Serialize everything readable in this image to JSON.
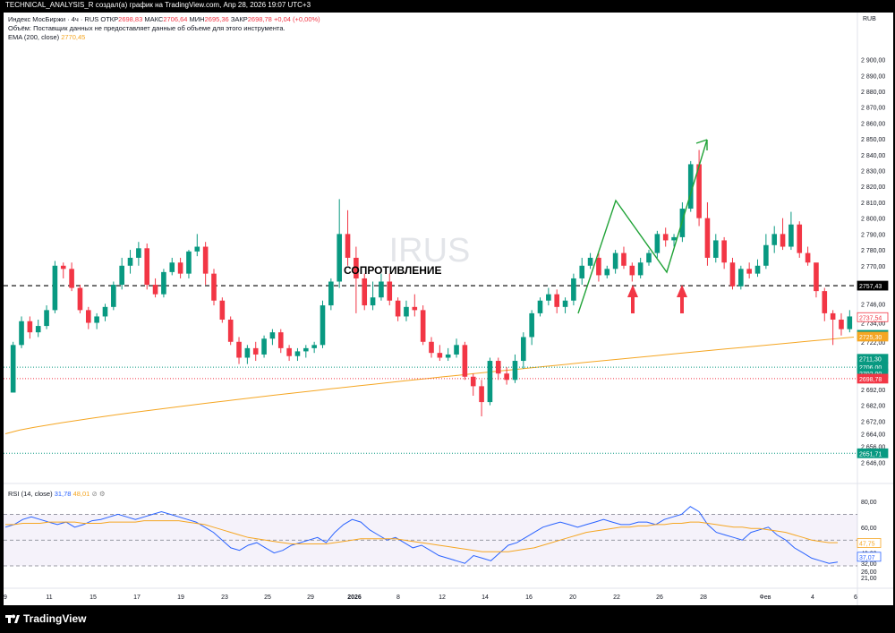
{
  "header": {
    "attribution": "TECHNICAL_ANALYSIS_R создал(а) график на TradingView.com, Апр 28, 2026 19:07 UTC+3"
  },
  "legend": {
    "symbol": "Индекс МосБиржи · 4ч · RUS",
    "open_label": "ОТКР",
    "open": "2698,83",
    "high_label": "МАКС",
    "high": "2706,64",
    "low_label": "МИН",
    "low": "2695,36",
    "close_label": "ЗАКР",
    "close": "2698,78",
    "change": "+0,04 (+0,00%)",
    "volume_note": "Объём: Поставщик данных не предоставляет данные об объеме для этого инструмента.",
    "ema_label": "EMA (200, close)",
    "ema_value": "2770,45",
    "rsi_label": "RSI (14, close)",
    "rsi_value": "31,78",
    "rsi_ma": "48,01"
  },
  "watermark": "IRUS",
  "annotation": "СОПРОТИВЛЕНИЕ",
  "currency": "RUB",
  "branding": "TradingView",
  "colors": {
    "up": "#089981",
    "down": "#f23645",
    "ema": "#f5a623",
    "rsi": "#2962ff",
    "rsi_ma": "#f5a623",
    "arrow_green": "#21a338",
    "arrow_red": "#f23645"
  },
  "chart_data": [
    {
      "type": "candlestick",
      "title": "Индекс МосБиржи · 4ч · RUS",
      "ylim": [
        2640,
        2915
      ],
      "y_ticks": [
        "2 900,00",
        "2 890,00",
        "2 880,00",
        "2 870,00",
        "2 860,00",
        "2 850,00",
        "2 840,00",
        "2 830,00",
        "2 820,00",
        "2 810,00",
        "2 800,00",
        "2 790,00",
        "2 780,00",
        "2 770,00",
        "2 757,43",
        "2 746,00",
        "2 734,00",
        "2 722,00",
        "2 711,30",
        "2 706,00",
        "2 698,78",
        "2 692,00",
        "2 682,00",
        "2 672,00",
        "2 664,00",
        "2 656,00",
        "2 651,71",
        "2 646,00"
      ],
      "x_ticks": [
        "9",
        "11",
        "15",
        "17",
        "19",
        "23",
        "25",
        "29",
        "2026",
        "8",
        "12",
        "14",
        "16",
        "20",
        "22",
        "26",
        "28",
        "Фев",
        "4",
        "6"
      ],
      "price_tags": [
        {
          "label": "2757,43",
          "value": 2757.43,
          "color": "#000000"
        },
        {
          "label": "2737,54",
          "value": 2737.54,
          "color": "#f23645"
        },
        {
          "label": "2726,40",
          "value": 2726.4,
          "color": "#089981"
        },
        {
          "label": "2725,30",
          "value": 2725.3,
          "color": "#f5a623"
        },
        {
          "label": "2711,30",
          "value": 2711.3,
          "color": "#089981"
        },
        {
          "label": "2706,00",
          "value": 2706.0,
          "color": "#089981"
        },
        {
          "label": "2702,00",
          "value": 2702.0,
          "color": "#089981"
        },
        {
          "label": "2698,78",
          "value": 2698.78,
          "color": "#f23645"
        },
        {
          "label": "2651,71",
          "value": 2651.71,
          "color": "#089981"
        }
      ],
      "resistance": 2757.43,
      "support_dotted": [
        2706.0,
        2651.71
      ],
      "candles": [
        [
          2690,
          2720,
          2690,
          2722
        ],
        [
          2720,
          2735,
          2718,
          2738
        ],
        [
          2735,
          2728,
          2724,
          2738
        ],
        [
          2728,
          2732,
          2725,
          2736
        ],
        [
          2732,
          2742,
          2730,
          2745
        ],
        [
          2742,
          2770,
          2740,
          2773
        ],
        [
          2770,
          2768,
          2762,
          2772
        ],
        [
          2768,
          2756,
          2754,
          2772
        ],
        [
          2756,
          2742,
          2740,
          2758
        ],
        [
          2742,
          2734,
          2730,
          2744
        ],
        [
          2734,
          2738,
          2730,
          2740
        ],
        [
          2738,
          2744,
          2735,
          2746
        ],
        [
          2744,
          2758,
          2742,
          2760
        ],
        [
          2758,
          2770,
          2755,
          2775
        ],
        [
          2770,
          2775,
          2765,
          2780
        ],
        [
          2775,
          2781,
          2770,
          2785
        ],
        [
          2781,
          2758,
          2755,
          2784
        ],
        [
          2758,
          2752,
          2750,
          2762
        ],
        [
          2752,
          2766,
          2750,
          2768
        ],
        [
          2766,
          2772,
          2764,
          2775
        ],
        [
          2772,
          2765,
          2762,
          2775
        ],
        [
          2765,
          2779,
          2762,
          2780
        ],
        [
          2779,
          2782,
          2776,
          2790
        ],
        [
          2782,
          2765,
          2758,
          2785
        ],
        [
          2765,
          2748,
          2745,
          2768
        ],
        [
          2748,
          2736,
          2734,
          2750
        ],
        [
          2736,
          2722,
          2720,
          2738
        ],
        [
          2722,
          2712,
          2708,
          2725
        ],
        [
          2712,
          2718,
          2708,
          2720
        ],
        [
          2718,
          2714,
          2710,
          2722
        ],
        [
          2714,
          2724,
          2712,
          2726
        ],
        [
          2724,
          2728,
          2720,
          2730
        ],
        [
          2728,
          2718,
          2715,
          2730
        ],
        [
          2718,
          2713,
          2710,
          2720
        ],
        [
          2713,
          2716,
          2710,
          2718
        ],
        [
          2716,
          2718,
          2712,
          2720
        ],
        [
          2718,
          2720,
          2715,
          2722
        ],
        [
          2720,
          2745,
          2718,
          2748
        ],
        [
          2745,
          2760,
          2742,
          2762
        ],
        [
          2760,
          2790,
          2756,
          2812
        ],
        [
          2790,
          2775,
          2770,
          2805
        ],
        [
          2775,
          2762,
          2740,
          2782
        ],
        [
          2762,
          2745,
          2742,
          2765
        ],
        [
          2745,
          2750,
          2742,
          2760
        ],
        [
          2750,
          2760,
          2748,
          2765
        ],
        [
          2760,
          2748,
          2745,
          2765
        ],
        [
          2748,
          2738,
          2735,
          2750
        ],
        [
          2738,
          2744,
          2735,
          2748
        ],
        [
          2744,
          2742,
          2738,
          2752
        ],
        [
          2742,
          2722,
          2720,
          2745
        ],
        [
          2722,
          2715,
          2712,
          2725
        ],
        [
          2715,
          2712,
          2710,
          2720
        ],
        [
          2712,
          2714,
          2710,
          2718
        ],
        [
          2714,
          2720,
          2712,
          2724
        ],
        [
          2720,
          2700,
          2698,
          2722
        ],
        [
          2700,
          2694,
          2688,
          2702
        ],
        [
          2694,
          2684,
          2675,
          2698
        ],
        [
          2684,
          2710,
          2682,
          2712
        ],
        [
          2710,
          2702,
          2698,
          2712
        ],
        [
          2702,
          2698,
          2695,
          2706
        ],
        [
          2698,
          2710,
          2696,
          2714
        ],
        [
          2710,
          2725,
          2705,
          2728
        ],
        [
          2725,
          2740,
          2720,
          2742
        ],
        [
          2740,
          2748,
          2738,
          2750
        ],
        [
          2748,
          2752,
          2745,
          2756
        ],
        [
          2752,
          2744,
          2740,
          2755
        ],
        [
          2744,
          2748,
          2740,
          2750
        ],
        [
          2748,
          2762,
          2745,
          2765
        ],
        [
          2762,
          2770,
          2758,
          2775
        ],
        [
          2770,
          2775,
          2768,
          2778
        ],
        [
          2775,
          2764,
          2760,
          2778
        ],
        [
          2764,
          2768,
          2762,
          2770
        ],
        [
          2768,
          2778,
          2765,
          2780
        ],
        [
          2778,
          2770,
          2768,
          2782
        ],
        [
          2770,
          2764,
          2760,
          2772
        ],
        [
          2764,
          2772,
          2762,
          2775
        ],
        [
          2772,
          2778,
          2770,
          2780
        ],
        [
          2778,
          2790,
          2775,
          2792
        ],
        [
          2790,
          2786,
          2782,
          2794
        ],
        [
          2786,
          2788,
          2782,
          2790
        ],
        [
          2788,
          2806,
          2785,
          2810
        ],
        [
          2806,
          2834,
          2804,
          2836
        ],
        [
          2834,
          2800,
          2795,
          2843
        ],
        [
          2800,
          2775,
          2770,
          2810
        ],
        [
          2775,
          2786,
          2772,
          2790
        ],
        [
          2786,
          2772,
          2768,
          2788
        ],
        [
          2772,
          2757,
          2755,
          2775
        ],
        [
          2757,
          2768,
          2755,
          2770
        ],
        [
          2768,
          2765,
          2762,
          2772
        ],
        [
          2765,
          2770,
          2763,
          2774
        ],
        [
          2770,
          2783,
          2768,
          2790
        ],
        [
          2783,
          2790,
          2778,
          2795
        ],
        [
          2790,
          2782,
          2780,
          2800
        ],
        [
          2782,
          2796,
          2780,
          2804
        ],
        [
          2796,
          2778,
          2775,
          2798
        ],
        [
          2778,
          2772,
          2770,
          2782
        ],
        [
          2772,
          2754,
          2750,
          2760
        ],
        [
          2754,
          2740,
          2735,
          2756
        ],
        [
          2740,
          2736,
          2720,
          2742
        ],
        [
          2736,
          2730,
          2726,
          2740
        ],
        [
          2730,
          2738,
          2728,
          2742
        ]
      ]
    },
    {
      "type": "line",
      "title": "RSI (14, close)",
      "ylim": [
        21,
        80
      ],
      "y_ticks": [
        "80,00",
        "60,00",
        "40,00",
        "32,00",
        "26,00",
        "21,00"
      ],
      "tags": [
        {
          "label": "47,75",
          "value": 47.75,
          "color": "#f5a623"
        },
        {
          "label": "37,07",
          "value": 37.07,
          "color": "#2962ff"
        }
      ],
      "bands": [
        70,
        50,
        30
      ],
      "series": [
        {
          "name": "RSI",
          "values": [
            60,
            62,
            66,
            68,
            66,
            64,
            62,
            64,
            60,
            62,
            65,
            66,
            68,
            70,
            68,
            66,
            68,
            70,
            72,
            70,
            68,
            66,
            64,
            60,
            56,
            50,
            44,
            42,
            46,
            48,
            44,
            40,
            42,
            46,
            48,
            50,
            52,
            48,
            56,
            62,
            66,
            64,
            58,
            54,
            50,
            52,
            48,
            44,
            46,
            42,
            38,
            36,
            34,
            32,
            38,
            36,
            34,
            40,
            46,
            48,
            52,
            56,
            60,
            62,
            64,
            62,
            60,
            62,
            64,
            66,
            64,
            62,
            62,
            64,
            64,
            62,
            66,
            68,
            70,
            76,
            72,
            62,
            56,
            54,
            52,
            50,
            56,
            58,
            60,
            54,
            50,
            44,
            40,
            36,
            34,
            32,
            33
          ]
        },
        {
          "name": "MA",
          "values": [
            62,
            62,
            63,
            63,
            63,
            64,
            64,
            64,
            64,
            63,
            63,
            63,
            64,
            64,
            64,
            64,
            65,
            65,
            65,
            65,
            65,
            64,
            63,
            62,
            60,
            58,
            56,
            54,
            52,
            51,
            50,
            49,
            48,
            47,
            47,
            47,
            47,
            47,
            48,
            49,
            50,
            51,
            51,
            51,
            51,
            51,
            50,
            49,
            48,
            47,
            46,
            45,
            44,
            43,
            42,
            41,
            41,
            41,
            41,
            42,
            43,
            44,
            46,
            48,
            50,
            52,
            54,
            56,
            57,
            58,
            59,
            60,
            60,
            61,
            61,
            62,
            62,
            63,
            63,
            64,
            64,
            63,
            62,
            61,
            60,
            60,
            59,
            59,
            58,
            57,
            56,
            54,
            52,
            50,
            49,
            48,
            48
          ]
        }
      ]
    }
  ]
}
